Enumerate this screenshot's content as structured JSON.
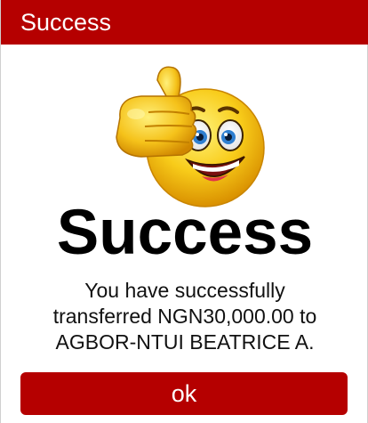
{
  "dialog": {
    "title": "Success",
    "headline": "Success",
    "message_lines": [
      "You have successfully",
      "transferred NGN30,000.00 to",
      "AGBOR-NTUI BEATRICE A."
    ],
    "ok_label": "ok",
    "emoji_icon": "thumbs-up-smiley-icon"
  },
  "colors": {
    "accent": "#b50000",
    "background": "#ffffff",
    "text": "#000000",
    "emoji_face": "#f5c518"
  }
}
